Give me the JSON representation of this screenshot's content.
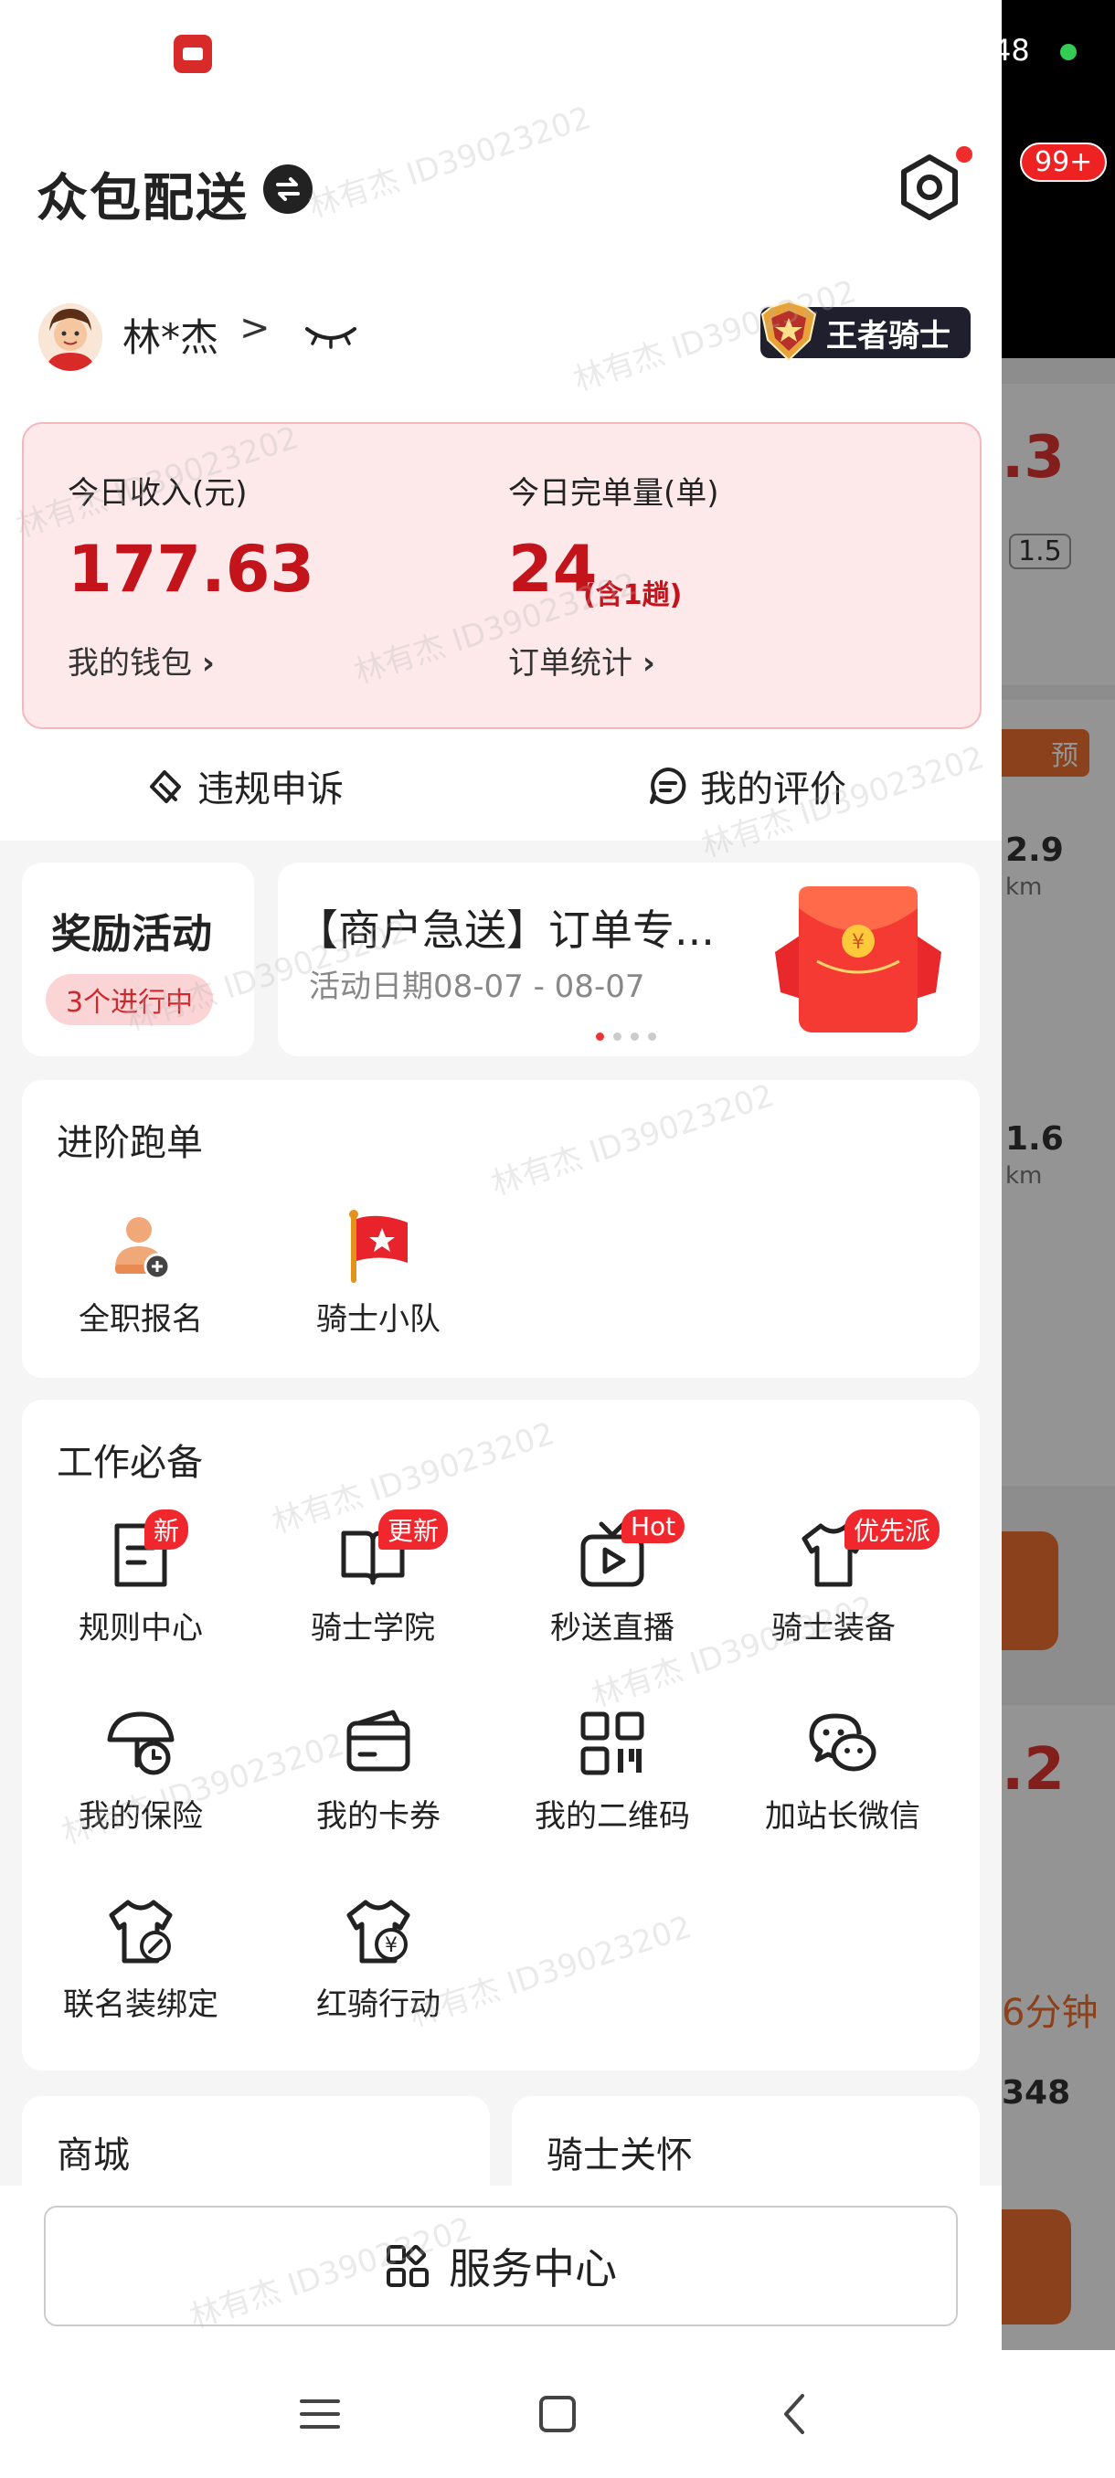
{
  "header": {
    "title": "众包配送",
    "user_name": "林*杰",
    "user_arrow": ">",
    "rank": "王者骑士"
  },
  "income": {
    "today_income_label": "今日收入(元)",
    "today_income_value": "177.63",
    "wallet_link": "我的钱包",
    "today_orders_label": "今日完单量(单)",
    "today_orders_value": "24",
    "today_orders_sub": "(含1趟)",
    "stats_link": "订单统计"
  },
  "actions": {
    "appeal": "违规申诉",
    "reviews": "我的评价"
  },
  "rewards": {
    "title": "奖励活动",
    "badge": "3个进行中"
  },
  "promo": {
    "title": "【商户急送】订单专...",
    "date": "活动日期08-07 - 08-07",
    "pages": 4,
    "active_page": 0
  },
  "advanced": {
    "title": "进阶跑单",
    "items": [
      {
        "label": "全职报名",
        "icon": "person-add-icon"
      },
      {
        "label": "骑士小队",
        "icon": "flag-icon"
      }
    ]
  },
  "work": {
    "title": "工作必备",
    "items": [
      {
        "label": "规则中心",
        "icon": "document-icon",
        "tag": "新"
      },
      {
        "label": "骑士学院",
        "icon": "book-icon",
        "tag": "更新"
      },
      {
        "label": "秒送直播",
        "icon": "tv-play-icon",
        "tag": "Hot"
      },
      {
        "label": "骑士装备",
        "icon": "shirt-icon",
        "tag": "优先派"
      },
      {
        "label": "我的保险",
        "icon": "umbrella-clock-icon",
        "tag": ""
      },
      {
        "label": "我的卡券",
        "icon": "card-icon",
        "tag": ""
      },
      {
        "label": "我的二维码",
        "icon": "qrcode-icon",
        "tag": ""
      },
      {
        "label": "加站长微信",
        "icon": "wechat-icon",
        "tag": ""
      },
      {
        "label": "联名装绑定",
        "icon": "shirt-link-icon",
        "tag": ""
      },
      {
        "label": "红骑行动",
        "icon": "shirt-yuan-icon",
        "tag": ""
      }
    ]
  },
  "bottom_cards": {
    "mall": "商城",
    "care": "骑士关怀"
  },
  "service_center": "服务中心",
  "background": {
    "notify_count": "99+",
    "battery": "48",
    "values": [
      ".3",
      "1.5",
      "预",
      "2.9",
      "km",
      "1.6",
      "km",
      ".2",
      "6分钟",
      "348"
    ]
  },
  "watermark": "林有杰 ID39023202",
  "colors": {
    "accent": "#c3141c",
    "card_bg": "#fde9ea",
    "tag_red": "#f0282d"
  }
}
